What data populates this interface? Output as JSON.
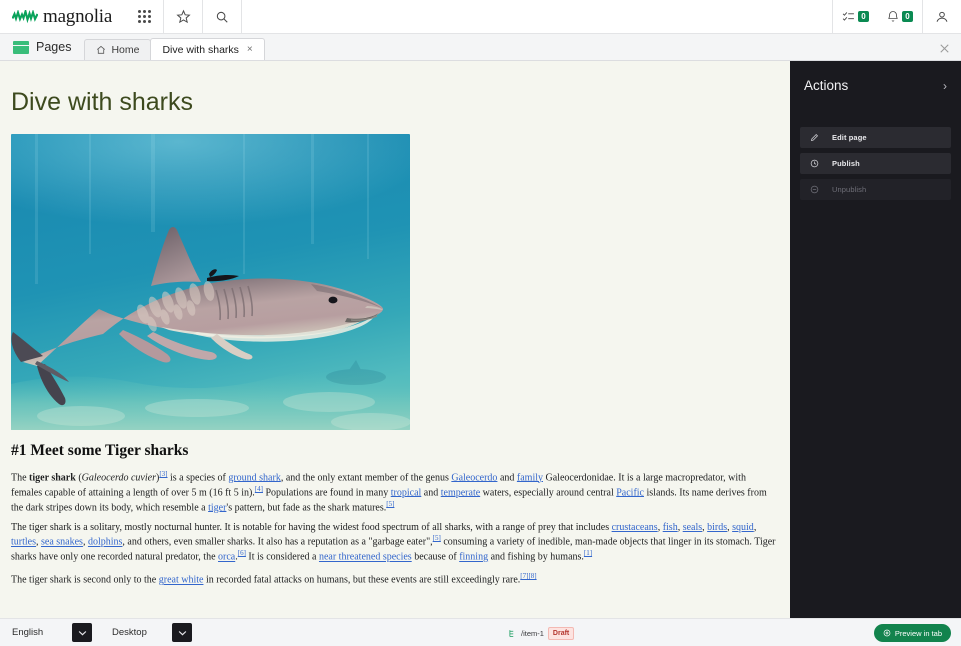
{
  "topbar": {
    "brand_name": "magnolia",
    "brand_color": "#0aa35b",
    "apps_icon": "grid-apps-icon",
    "favorites_icon": "star-icon",
    "search_icon": "search-icon",
    "tasks_icon": "tasks-icon",
    "tasks_count": "0",
    "notifications_icon": "bell-icon",
    "notifications_count": "0",
    "user_icon": "user-avatar-icon",
    "badge_color": "#0a8a52"
  },
  "tabbar": {
    "app_label": "Pages",
    "app_icon": "pages-icon",
    "close_all_icon": "close-icon",
    "tabs": [
      {
        "label": "Home",
        "icon": "home-icon",
        "active": false,
        "closable": false
      },
      {
        "label": "Dive with sharks",
        "icon": "",
        "active": true,
        "closable": true
      }
    ],
    "tab_close_glyph": "×"
  },
  "page": {
    "title": "Dive with sharks",
    "title_color": "#3d4a1e",
    "background_color": "#f5f6ef",
    "hero_image_alt": "Tiger shark swimming underwater over a sandy seabed"
  },
  "article": {
    "heading": "#1 Meet some Tiger sharks",
    "paragraphs": [
      "The tiger shark (Galeocerdo cuvier)[3] is a species of ground shark, and the only extant member of the genus Galeocerdo and family Galeocerdonidae. It is a large macropredator, with females capable of attaining a length of over 5 m (16 ft 5 in).[4] Populations are found in many tropical and temperate waters, especially around central Pacific islands. Its name derives from the dark stripes down its body, which resemble a tiger's pattern, but fade as the shark matures.[5]",
      "The tiger shark is a solitary, mostly nocturnal hunter. It is notable for having the widest food spectrum of all sharks, with a range of prey that includes crustaceans, fish, seals, birds, squid, turtles, sea snakes, dolphins, and others, even smaller sharks. It also has a reputation as a \"garbage eater\",[5] consuming a variety of inedible, man-made objects that linger in its stomach. Tiger sharks have only one recorded natural predator, the orca.[6] It is considered a near threatened species because of finning and fishing by humans.[1]",
      "The tiger shark is second only to the great white in recorded fatal attacks on humans, but these events are still exceedingly rare.[7][8]"
    ],
    "p1": {
      "t1": "The ",
      "b1": "tiger shark",
      "t2": " (",
      "i1": "Galeocerdo cuvier",
      "t3": ")",
      "r1": "[3]",
      "t4": " is a species of ",
      "l1": "ground shark",
      "t5": ", and the only extant member of the genus ",
      "l2": "Galeocerdo",
      "t6": " and ",
      "l3": "family",
      "t7": " Galeocerdonidae. It is a large macropredator, with females capable of attaining a length of over 5 m (16 ft 5 in).",
      "r2": "[4]",
      "t8": " Populations are found in many ",
      "l4": "tropical",
      "t9": " and ",
      "l5": "temperate",
      "t10": " waters, especially around central ",
      "l6": "Pacific",
      "t11": " islands. Its name derives from the dark stripes down its body, which resemble a ",
      "l7": "tiger",
      "t12": "'s pattern, but fade as the shark matures.",
      "r3": "[5]"
    },
    "p2": {
      "t1": "The tiger shark is a solitary, mostly nocturnal hunter. It is notable for having the widest food spectrum of all sharks, with a range of prey that includes ",
      "l1": "crustaceans",
      "s1": ", ",
      "l2": "fish",
      "s2": ", ",
      "l3": "seals",
      "s3": ", ",
      "l4": "birds",
      "s4": ", ",
      "l5": "squid",
      "s5": ", ",
      "l6": "turtles",
      "s6": ", ",
      "l7": "sea snakes",
      "s7": ", ",
      "l8": "dolphins",
      "t2": ", and others, even smaller sharks. It also has a reputation as a \"garbage eater\",",
      "r1": "[5]",
      "t3": " consuming a variety of inedible, man-made objects that linger in its stomach. Tiger sharks have only one recorded natural predator, the ",
      "l9": "orca",
      "t4": ".",
      "r2": "[6]",
      "t5": " It is considered a ",
      "l10": "near threatened species",
      "t6": " because of ",
      "l11": "finning",
      "t7": " and fishing by humans.",
      "r3": "[1]"
    },
    "p3": {
      "t1": "The tiger shark is second only to the ",
      "l1": "great white",
      "t2": " in recorded fatal attacks on humans, but these events are still exceedingly rare.",
      "r1": "[7][8]"
    }
  },
  "actions": {
    "title": "Actions",
    "collapse_icon": "chevron-right-icon",
    "items": [
      {
        "label": "Edit page",
        "icon": "pencil-icon",
        "disabled": false
      },
      {
        "label": "Publish",
        "icon": "publish-clock-icon",
        "disabled": false
      },
      {
        "label": "Unpublish",
        "icon": "unpublish-icon",
        "disabled": true
      }
    ],
    "panel_color": "#1a1a1f"
  },
  "bottombar": {
    "language": "English",
    "language_dropdown_icon": "chevron-down-icon",
    "device": "Desktop",
    "device_dropdown_icon": "chevron-down-icon",
    "status_icon": "site-tree-icon",
    "status_path": "/item-1",
    "status_badge": "Draft",
    "status_badge_color": "#b3342c",
    "preview_label": "Preview in tab",
    "preview_icon": "preview-eye-icon",
    "preview_color": "#12834d"
  }
}
